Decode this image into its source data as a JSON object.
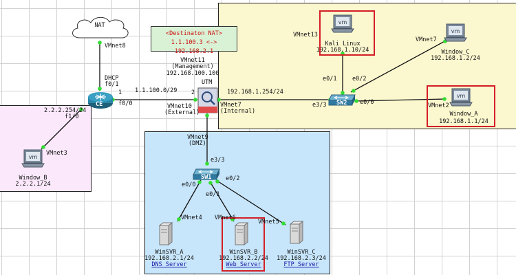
{
  "nat": {
    "title": "<Destinaton NAT>",
    "rule": "1.1.100.3 <-> 192.168.2.1"
  },
  "cloud_label": "NAT",
  "devices": {
    "ce": "CE",
    "utm": "UTM",
    "sw1": "SW1",
    "sw2": "SW2",
    "kali": {
      "name": "Kali Linux",
      "ip": "192.168.1.10/24"
    },
    "window_c": {
      "name": "Window_C",
      "ip": "192.168.1.2/24"
    },
    "window_a": {
      "name": "Window_A",
      "ip": "192.168.1.1/24"
    },
    "window_b": {
      "name": "Window_B",
      "ip": "2.2.2.1/24"
    },
    "winsvr_a": {
      "name": "WinSVR_A",
      "ip": "192.168.2.1/24",
      "role": "DNS_Server"
    },
    "winsvr_b": {
      "name": "WinSVR_B",
      "ip": "192.168.2.2/24",
      "role": "Web_Server"
    },
    "winsvr_c": {
      "name": "WinSVR_C",
      "ip": "192.168.2.3/24",
      "role": "FTP_Server"
    }
  },
  "labels": {
    "vmnet8": "VMnet8",
    "dhcp": "DHCP",
    "ce_f01": "f0/1",
    "ce_f00": "f0/0",
    "ce_p1": "1",
    "utm_p2": "2",
    "link_ce_utm": "1.1.100.0/29",
    "vmnet11": "VMnet11",
    "management": "(Management)",
    "mgmt_ip": "192.168.100.100",
    "vmnet10": "VMnet10",
    "external": "(External)",
    "internal_net": "192.168.1.254/24",
    "vmnet7_int": "VMnet7",
    "internal": "(Internal)",
    "vmnet9": "VMnet9",
    "dmz": "(DMZ)",
    "ce_gw": "2.2.2.254/24",
    "ce_f10": "f1/0",
    "vmnet3": "VMnet3",
    "vmnet13": "VMnet13",
    "vmnet7_c": "VMnet7",
    "vmnet2": "VMnet2",
    "sw2_e01": "e0/1",
    "sw2_e02": "e0/2",
    "sw2_e00": "e0/0",
    "sw2_e33": "e3/3",
    "sw1_e33": "e3/3",
    "sw1_e00": "e0/0",
    "sw1_e01": "e0/1",
    "sw1_e02": "e0/2",
    "vmnet4": "VMnet4",
    "vmnet6": "VMnet6",
    "vmnet5": "VMnet5"
  },
  "colors": {
    "link": "#111111",
    "endpoint": "#33dd33",
    "highlight": "#d41e26",
    "router": "#1f6f8b"
  }
}
